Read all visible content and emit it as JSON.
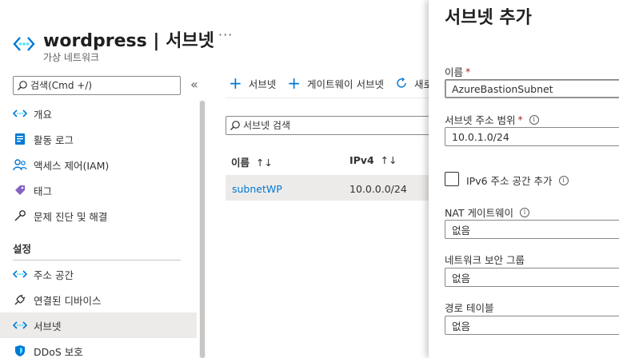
{
  "header": {
    "title": "wordpress | 서브넷",
    "subtitle": "가상 네트워크",
    "more": "···"
  },
  "nav": {
    "search_placeholder": "검색(Cmd +/)",
    "collapse": "«",
    "items": [
      {
        "label": "개요",
        "icon": "vnet-icon"
      },
      {
        "label": "활동 로그",
        "icon": "activity-log-icon"
      },
      {
        "label": "액세스 제어(IAM)",
        "icon": "iam-icon"
      },
      {
        "label": "태그",
        "icon": "tag-icon"
      },
      {
        "label": "문제 진단 및 해결",
        "icon": "wrench-icon"
      }
    ],
    "section_title": "설정",
    "settings_items": [
      {
        "label": "주소 공간",
        "icon": "address-space-icon"
      },
      {
        "label": "연결된 디바이스",
        "icon": "plug-icon"
      },
      {
        "label": "서브넷",
        "icon": "subnet-icon",
        "active": true
      },
      {
        "label": "DDoS 보호",
        "icon": "shield-icon"
      }
    ]
  },
  "toolbar": {
    "add_subnet": "서브넷",
    "add_gateway_subnet": "게이트웨이 서브넷",
    "refresh": "새로"
  },
  "main": {
    "search_placeholder": "서브넷 검색",
    "columns": [
      "이름",
      "IPv4"
    ],
    "sort_glyph": "↑↓",
    "rows": [
      {
        "name": "subnetWP",
        "ipv4": "10.0.0.0/24"
      }
    ]
  },
  "panel": {
    "title": "서브넷 추가",
    "name_label": "이름",
    "name_value": "AzureBastionSubnet",
    "range_label": "서브넷 주소 범위",
    "range_value": "10.0.1.0/24",
    "ipv6_label": "IPv6 주소 공간 추가",
    "nat_label": "NAT 게이트웨이",
    "nat_value": "없음",
    "nsg_label": "네트워크 보안 그룹",
    "nsg_value": "없음",
    "route_label": "경로 테이블",
    "route_value": "없음",
    "required_mark": "*",
    "info_glyph": "i"
  },
  "colors": {
    "accent": "#0078d4",
    "required": "#a4262c",
    "selected_row": "#edebe9"
  }
}
